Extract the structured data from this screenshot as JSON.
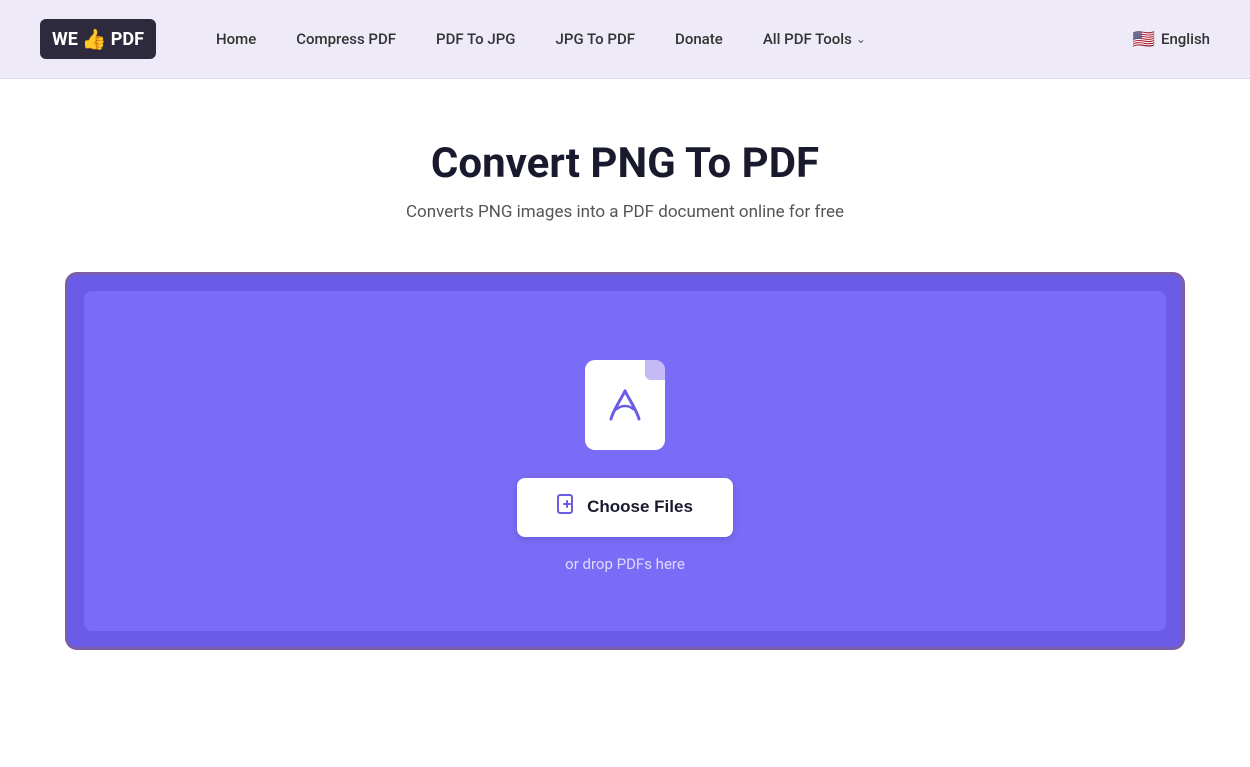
{
  "logo": {
    "we": "WE",
    "pdf": "PDF",
    "thumb_symbol": "👍"
  },
  "nav": {
    "items": [
      {
        "id": "home",
        "label": "Home",
        "href": "#"
      },
      {
        "id": "compress-pdf",
        "label": "Compress PDF",
        "href": "#"
      },
      {
        "id": "pdf-to-jpg",
        "label": "PDF To JPG",
        "href": "#"
      },
      {
        "id": "jpg-to-pdf",
        "label": "JPG To PDF",
        "href": "#"
      },
      {
        "id": "donate",
        "label": "Donate",
        "href": "#"
      },
      {
        "id": "all-pdf-tools",
        "label": "All PDF Tools",
        "href": "#"
      }
    ]
  },
  "language": {
    "flag": "🇺🇸",
    "label": "English"
  },
  "main": {
    "title": "Convert PNG To PDF",
    "subtitle": "Converts PNG images into a PDF document online for free",
    "choose_files_label": "Choose Files",
    "drop_text": "or drop PDFs here"
  },
  "colors": {
    "purple_dark": "#6b5ce7",
    "purple_mid": "#7b6cf7",
    "purple_border": "#7b5ea7",
    "white": "#ffffff",
    "dark_text": "#1a1a2e"
  }
}
